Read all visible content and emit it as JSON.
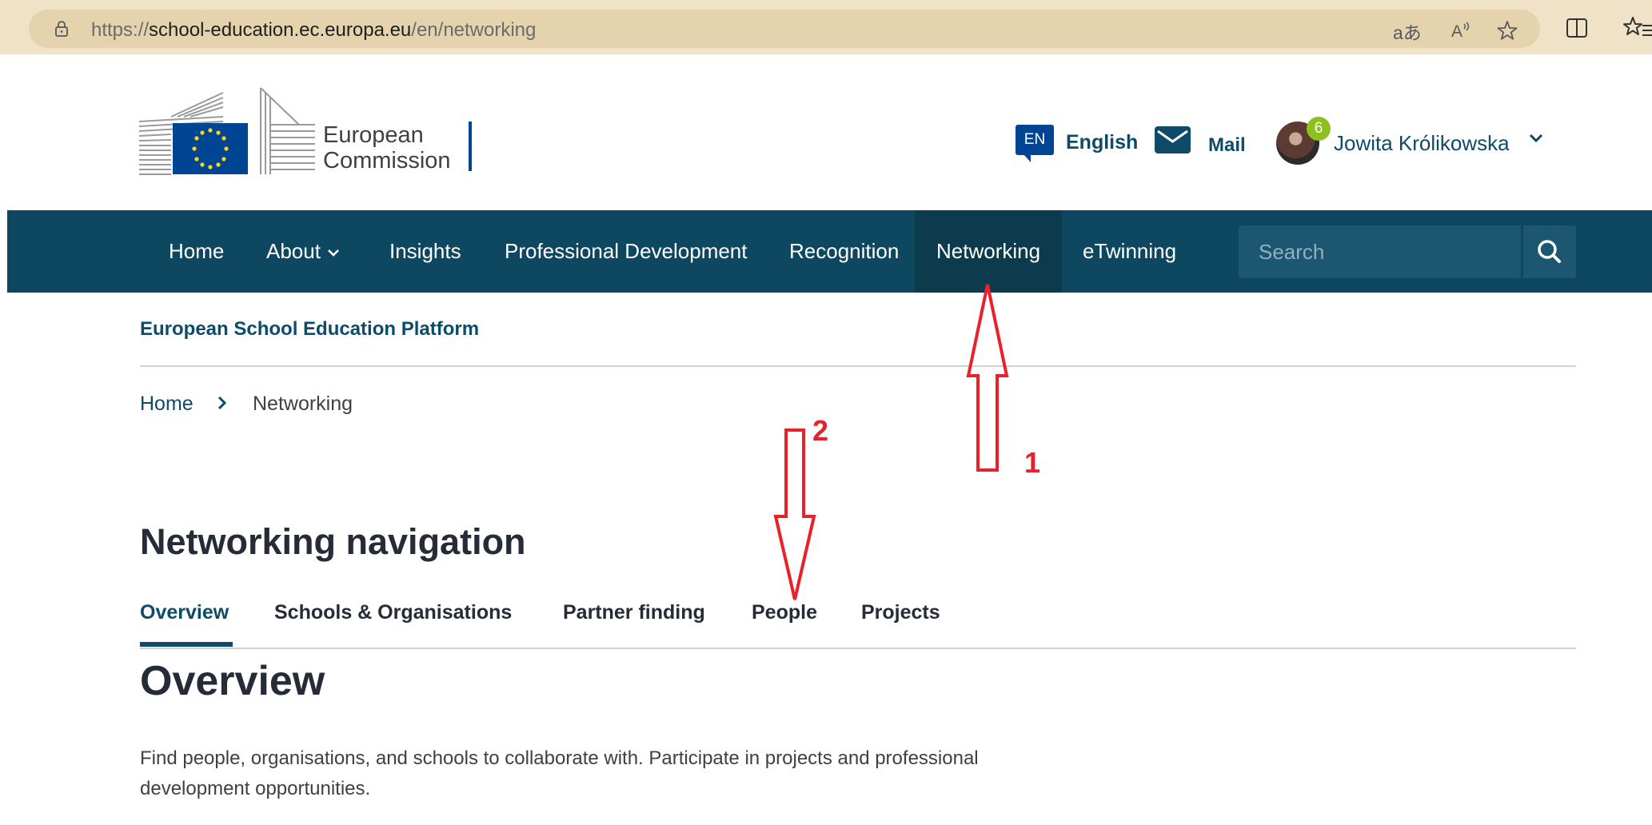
{
  "browser": {
    "url_scheme": "https://",
    "url_host": "school-education.ec.europa.eu",
    "url_path": "/en/networking",
    "read_aloud_label": "aあ"
  },
  "header": {
    "logo_line1": "European",
    "logo_line2": "Commission",
    "lang_code": "EN",
    "lang_label": "English",
    "mail_label": "Mail",
    "notification_count": "6",
    "user_name": "Jowita Królikowska"
  },
  "nav": {
    "items": [
      {
        "label": "Home"
      },
      {
        "label": "About"
      },
      {
        "label": "Insights"
      },
      {
        "label": "Professional Development"
      },
      {
        "label": "Recognition"
      },
      {
        "label": "Networking"
      },
      {
        "label": "eTwinning"
      }
    ],
    "active": "Networking",
    "search_placeholder": "Search"
  },
  "subheader": {
    "platform_title": "European School Education Platform"
  },
  "breadcrumb": {
    "home": "Home",
    "current": "Networking"
  },
  "networking_nav": {
    "title": "Networking navigation",
    "tabs": [
      {
        "label": "Overview"
      },
      {
        "label": "Schools & Organisations"
      },
      {
        "label": "Partner finding"
      },
      {
        "label": "People"
      },
      {
        "label": "Projects"
      }
    ],
    "active_tab": "Overview"
  },
  "content": {
    "heading": "Overview",
    "intro_line1": "Find people, organisations, and schools to collaborate with. Participate in projects and professional",
    "intro_line2": "development opportunities."
  },
  "annotations": {
    "label_1": "1",
    "label_2": "2",
    "color": "#e8212b"
  },
  "colors": {
    "nav_bg": "#0e4760",
    "brand_text": "#0e4b69",
    "ec_blue": "#004494",
    "badge_green": "#8dbf1e"
  }
}
